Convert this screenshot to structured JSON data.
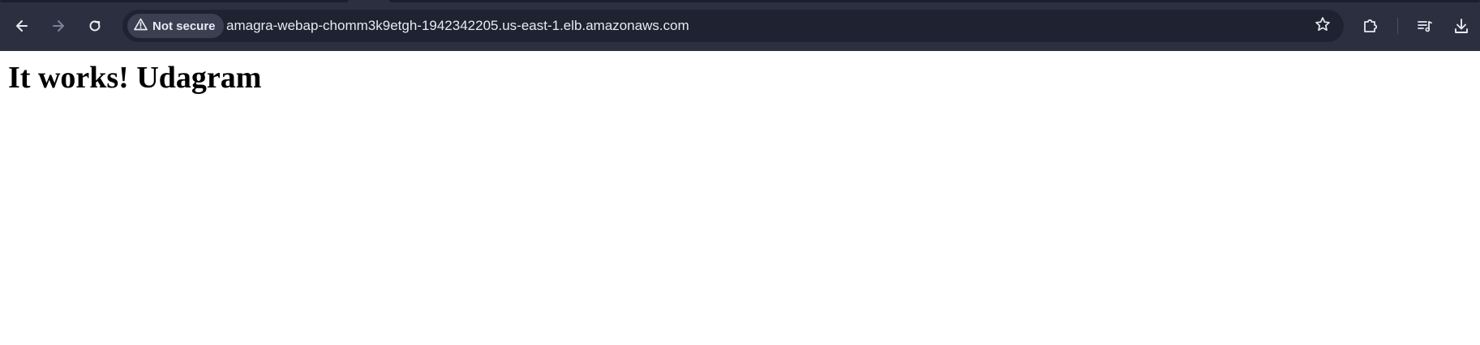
{
  "browser": {
    "nav": {
      "back_icon": "back-arrow-icon",
      "forward_icon": "forward-arrow-icon",
      "reload_icon": "reload-icon"
    },
    "omnibox": {
      "security_label": "Not secure",
      "security_icon": "warning-triangle-icon",
      "url": "amagra-webap-chomm3k9etgh-1942342205.us-east-1.elb.amazonaws.com",
      "bookmark_icon": "star-icon"
    },
    "toolbar": {
      "extensions_icon": "puzzle-piece-icon",
      "media_icon": "media-queue-icon",
      "downloads_icon": "download-icon"
    },
    "colors": {
      "chrome_background": "#2b2f40",
      "omnibox_background": "#1e2231",
      "chip_background": "#3a3f52",
      "icon_color": "#e8eaf0"
    }
  },
  "page": {
    "heading": "It works! Udagram"
  }
}
